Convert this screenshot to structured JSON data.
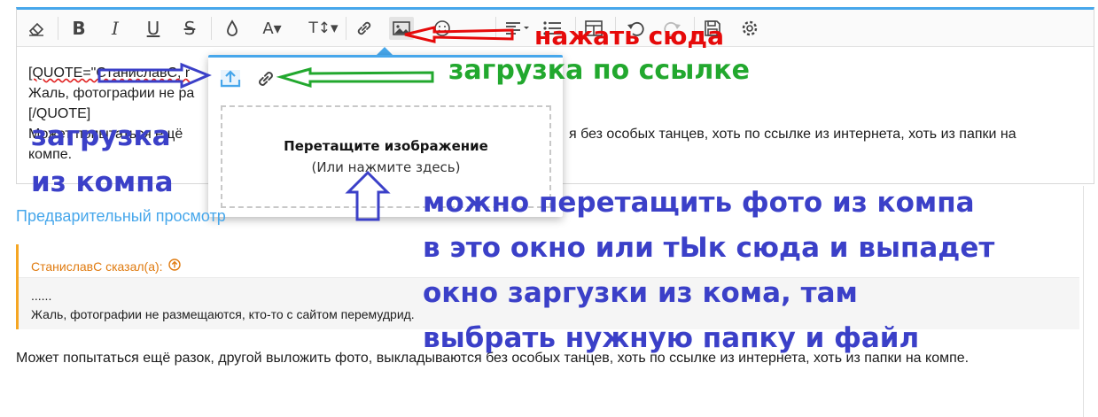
{
  "toolbar": {
    "buttons": [
      {
        "name": "eraser-icon"
      },
      {
        "name": "bold-icon",
        "label": "B"
      },
      {
        "name": "italic-icon",
        "label": "I"
      },
      {
        "name": "underline-icon",
        "label": "U"
      },
      {
        "name": "strikethrough-icon",
        "label": "S"
      },
      {
        "name": "text-color-icon"
      },
      {
        "name": "font-family-icon",
        "label": "A▾"
      },
      {
        "name": "font-size-icon",
        "label": "T↕▾"
      },
      {
        "name": "link-icon"
      },
      {
        "name": "image-icon"
      },
      {
        "name": "emoji-icon"
      },
      {
        "name": "align-icon"
      },
      {
        "name": "list-icon"
      },
      {
        "name": "table-icon"
      },
      {
        "name": "undo-icon"
      },
      {
        "name": "redo-icon"
      },
      {
        "name": "save-draft-icon"
      },
      {
        "name": "settings-icon"
      }
    ]
  },
  "editor": {
    "line1": "[QUOTE=\"СтаниславС, r",
    "line2": "Жаль, фотографии не ра",
    "line3": "[/QUOTE]",
    "line4_start": "Может попытаться ещё",
    "line4_end": "я без особых танцев, хоть по ссылке из интернета, хоть из папки на",
    "line5": "компе."
  },
  "image_popup": {
    "upload_tab_icon": "upload-icon",
    "url_tab_icon": "link-icon",
    "drop_title": "Перетащите изображение",
    "drop_subtitle": "(Или нажмите здесь)"
  },
  "preview_link": "Предварительный просмотр",
  "quote": {
    "author": "СтаниславС сказал(а):",
    "author_icon": "arrow-up-circle-icon",
    "line1": "......",
    "line2": "Жаль, фотографии не размещаются, кто-то с сайтом перемудрид."
  },
  "body_text": "Может попытаться ещё разок, другой выложить фото, выкладываются без особых танцев, хоть по ссылке из интернета, хоть из папки на компе.",
  "annotations": {
    "red": "нажать сюда",
    "green": "загрузка по ссылке",
    "blue_left": [
      "загрузка",
      "из компа"
    ],
    "blue_right": [
      "можно перетащить фото из компа",
      "в это окно или тЫк сюда и выпадет",
      "окно заргузки из кома, там",
      "выбрать нужную папку и файл"
    ],
    "colors": {
      "red": "#e60a0a",
      "green": "#22a82e",
      "blue": "#3b40c8"
    }
  }
}
